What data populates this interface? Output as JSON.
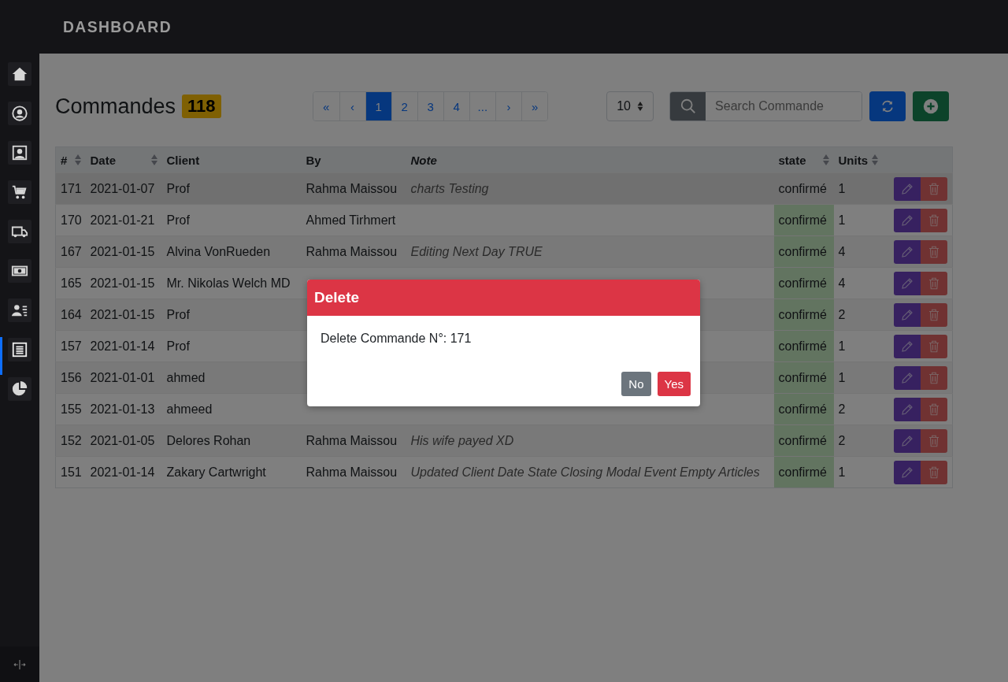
{
  "header": {
    "logo": "DASHBOARD"
  },
  "sidebar": {
    "items": [
      {
        "selected": false
      },
      {
        "selected": false
      },
      {
        "selected": false
      },
      {
        "selected": false
      },
      {
        "selected": false
      },
      {
        "selected": false
      },
      {
        "selected": false
      },
      {
        "selected": true
      },
      {
        "selected": false
      }
    ]
  },
  "toolbar": {
    "title": "Commandes",
    "count": "118",
    "pages": [
      {
        "label": "«",
        "selected": false
      },
      {
        "label": "‹",
        "selected": false
      },
      {
        "label": "1",
        "selected": true
      },
      {
        "label": "2",
        "selected": false
      },
      {
        "label": "3",
        "selected": false
      },
      {
        "label": "4",
        "selected": false
      },
      {
        "label": "...",
        "selected": false
      },
      {
        "label": "›",
        "selected": false
      },
      {
        "label": "»",
        "selected": false
      }
    ],
    "per_page": "10",
    "search": {
      "placeholder": "Search Commande"
    }
  },
  "table": {
    "columns": [
      {
        "label": "#",
        "kind": "plain",
        "sortable": true
      },
      {
        "label": "Date",
        "kind": "plain",
        "sortable": true
      },
      {
        "label": "Client",
        "kind": "plain",
        "sortable": false
      },
      {
        "label": "By",
        "kind": "plain",
        "sortable": false
      },
      {
        "label": "Note",
        "kind": "note",
        "sortable": false
      },
      {
        "label": "state",
        "kind": "state",
        "sortable": true
      },
      {
        "label": "Units",
        "kind": "plain",
        "sortable": true
      }
    ],
    "rows": [
      {
        "id": "171",
        "date": "2021-01-07",
        "client": "Prof",
        "by": "Rahma Maissou",
        "note": "charts Testing",
        "state": "confirmé",
        "units": "1",
        "selected": true
      },
      {
        "id": "170",
        "date": "2021-01-21",
        "client": "Prof",
        "by": "Ahmed Tirhmert",
        "note": "",
        "state": "confirmé",
        "units": "1",
        "selected": false
      },
      {
        "id": "167",
        "date": "2021-01-15",
        "client": "Alvina VonRueden",
        "by": "Rahma Maissou",
        "note": "Editing Next Day TRUE",
        "state": "confirmé",
        "units": "4",
        "selected": false
      },
      {
        "id": "165",
        "date": "2021-01-15",
        "client": "Mr. Nikolas Welch MD",
        "by": "",
        "note": "",
        "state": "confirmé",
        "units": "4",
        "selected": false
      },
      {
        "id": "164",
        "date": "2021-01-15",
        "client": "Prof",
        "by": "",
        "note": "",
        "state": "confirmé",
        "units": "2",
        "selected": false
      },
      {
        "id": "157",
        "date": "2021-01-14",
        "client": "Prof",
        "by": "",
        "note": "",
        "state": "confirmé",
        "units": "1",
        "selected": false
      },
      {
        "id": "156",
        "date": "2021-01-01",
        "client": "ahmed",
        "by": "",
        "note": "",
        "state": "confirmé",
        "units": "1",
        "selected": false
      },
      {
        "id": "155",
        "date": "2021-01-13",
        "client": "ahmeed",
        "by": "",
        "note": "",
        "state": "confirmé",
        "units": "2",
        "selected": false
      },
      {
        "id": "152",
        "date": "2021-01-05",
        "client": "Delores Rohan",
        "by": "Rahma Maissou",
        "note": "His wife payed XD",
        "state": "confirmé",
        "units": "2",
        "selected": false
      },
      {
        "id": "151",
        "date": "2021-01-14",
        "client": "Zakary Cartwright",
        "by": "Rahma Maissou",
        "note": "Updated Client Date State Closing Modal Event Empty Articles",
        "state": "confirmé",
        "units": "1",
        "selected": false
      }
    ]
  },
  "modal": {
    "title": "Delete",
    "message": "Delete Commande N°: 171",
    "buttons": [
      {
        "label": "No",
        "kind": "secondary"
      },
      {
        "label": "Yes",
        "kind": "danger"
      }
    ]
  }
}
